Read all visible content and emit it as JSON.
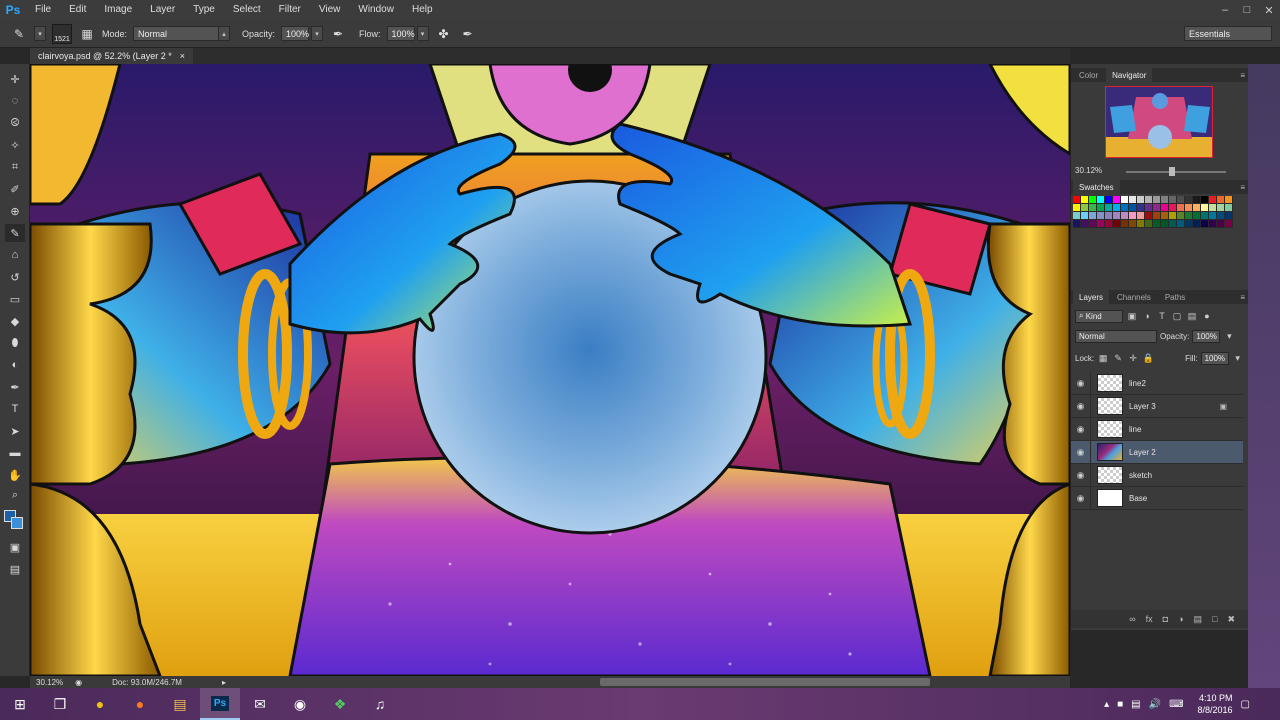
{
  "app": {
    "logo": "Ps",
    "menu": [
      "File",
      "Edit",
      "Image",
      "Layer",
      "Type",
      "Select",
      "Filter",
      "View",
      "Window",
      "Help"
    ],
    "window_controls": [
      "minimize-icon",
      "maximize-icon",
      "close-icon"
    ]
  },
  "options_bar": {
    "brush_size": "1521",
    "mode_label": "Mode:",
    "mode_value": "Normal",
    "opacity_label": "Opacity:",
    "opacity_value": "100%",
    "flow_label": "Flow:",
    "flow_value": "100%",
    "workspace": "Essentials"
  },
  "document": {
    "tab_title": "clairvoya.psd @ 52.2% (Layer 2 *",
    "close": "×"
  },
  "status_bar": {
    "zoom": "30.12%",
    "doc_size": "Doc: 93.0M/246.7M"
  },
  "panels": {
    "top_tabs": [
      "Color",
      "Navigator"
    ],
    "active_top_tab": "Navigator",
    "navigator_zoom": "30.12%",
    "swatches_tab": "Swatches",
    "layer_tabs": [
      "Layers",
      "Channels",
      "Paths"
    ],
    "filter_kind": "Kind",
    "blend_mode": "Normal",
    "opacity_label": "Opacity:",
    "opacity_value": "100%",
    "lock_label": "Lock:",
    "fill_label": "Fill:",
    "fill_value": "100%"
  },
  "layers": [
    {
      "name": "line2",
      "thumb": "transparent",
      "locked": false,
      "selected": false
    },
    {
      "name": "Layer 3",
      "thumb": "transparent",
      "locked": true,
      "selected": false
    },
    {
      "name": "line",
      "thumb": "transparent",
      "locked": false,
      "selected": false
    },
    {
      "name": "Layer 2",
      "thumb": "art",
      "locked": false,
      "selected": true
    },
    {
      "name": "sketch",
      "thumb": "transparent",
      "locked": false,
      "selected": false
    },
    {
      "name": "Base",
      "thumb": "white",
      "locked": false,
      "selected": false
    }
  ],
  "colors": {
    "foreground": "#1e5fa8",
    "background": "#3a8fd8",
    "accent": "#31a8ff"
  },
  "swatches": [
    "#ff0000",
    "#ffff00",
    "#00ff00",
    "#00ffff",
    "#0000ff",
    "#ff00ff",
    "#ffffff",
    "#e6e6e6",
    "#cccccc",
    "#b3b3b3",
    "#999999",
    "#808080",
    "#666666",
    "#4d4d4d",
    "#333333",
    "#1a1a1a",
    "#000000",
    "#ed1c24",
    "#f26522",
    "#f7941d",
    "#fff200",
    "#8dc63f",
    "#39b54a",
    "#00a651",
    "#00a99d",
    "#00aeef",
    "#0072bc",
    "#0054a6",
    "#2e3192",
    "#662d91",
    "#92278f",
    "#ec008c",
    "#ed145b",
    "#f26c4f",
    "#f68e56",
    "#fbaf5d",
    "#fff799",
    "#c4df9b",
    "#a3d39c",
    "#82ca9d",
    "#7accc8",
    "#6dcff6",
    "#7da7d9",
    "#8393ca",
    "#8781bd",
    "#a186be",
    "#bd8cbf",
    "#f49ac2",
    "#f5989d",
    "#9e0b0f",
    "#a0410d",
    "#a36209",
    "#aba000",
    "#598527",
    "#1a7b30",
    "#007236",
    "#00746b",
    "#0076a3",
    "#004b80",
    "#003471",
    "#1b1464",
    "#440e62",
    "#630460",
    "#9e005d",
    "#9e0039",
    "#790000",
    "#7b2e00",
    "#7d4900",
    "#827b00",
    "#406618",
    "#005e20",
    "#005826",
    "#005952",
    "#005b7f",
    "#003663",
    "#002157",
    "#0d004c",
    "#32004b",
    "#4b0049",
    "#7b0046"
  ],
  "taskbar": {
    "icons": [
      "windows-start-icon",
      "task-view-icon",
      "chrome-icon",
      "firefox-icon",
      "file-explorer-icon",
      "photoshop-icon",
      "chat-icon",
      "steam-icon",
      "color-app-icon",
      "music-icon"
    ],
    "photoshop_label": "Ps",
    "time": "4:10 PM",
    "date": "8/8/2016"
  }
}
